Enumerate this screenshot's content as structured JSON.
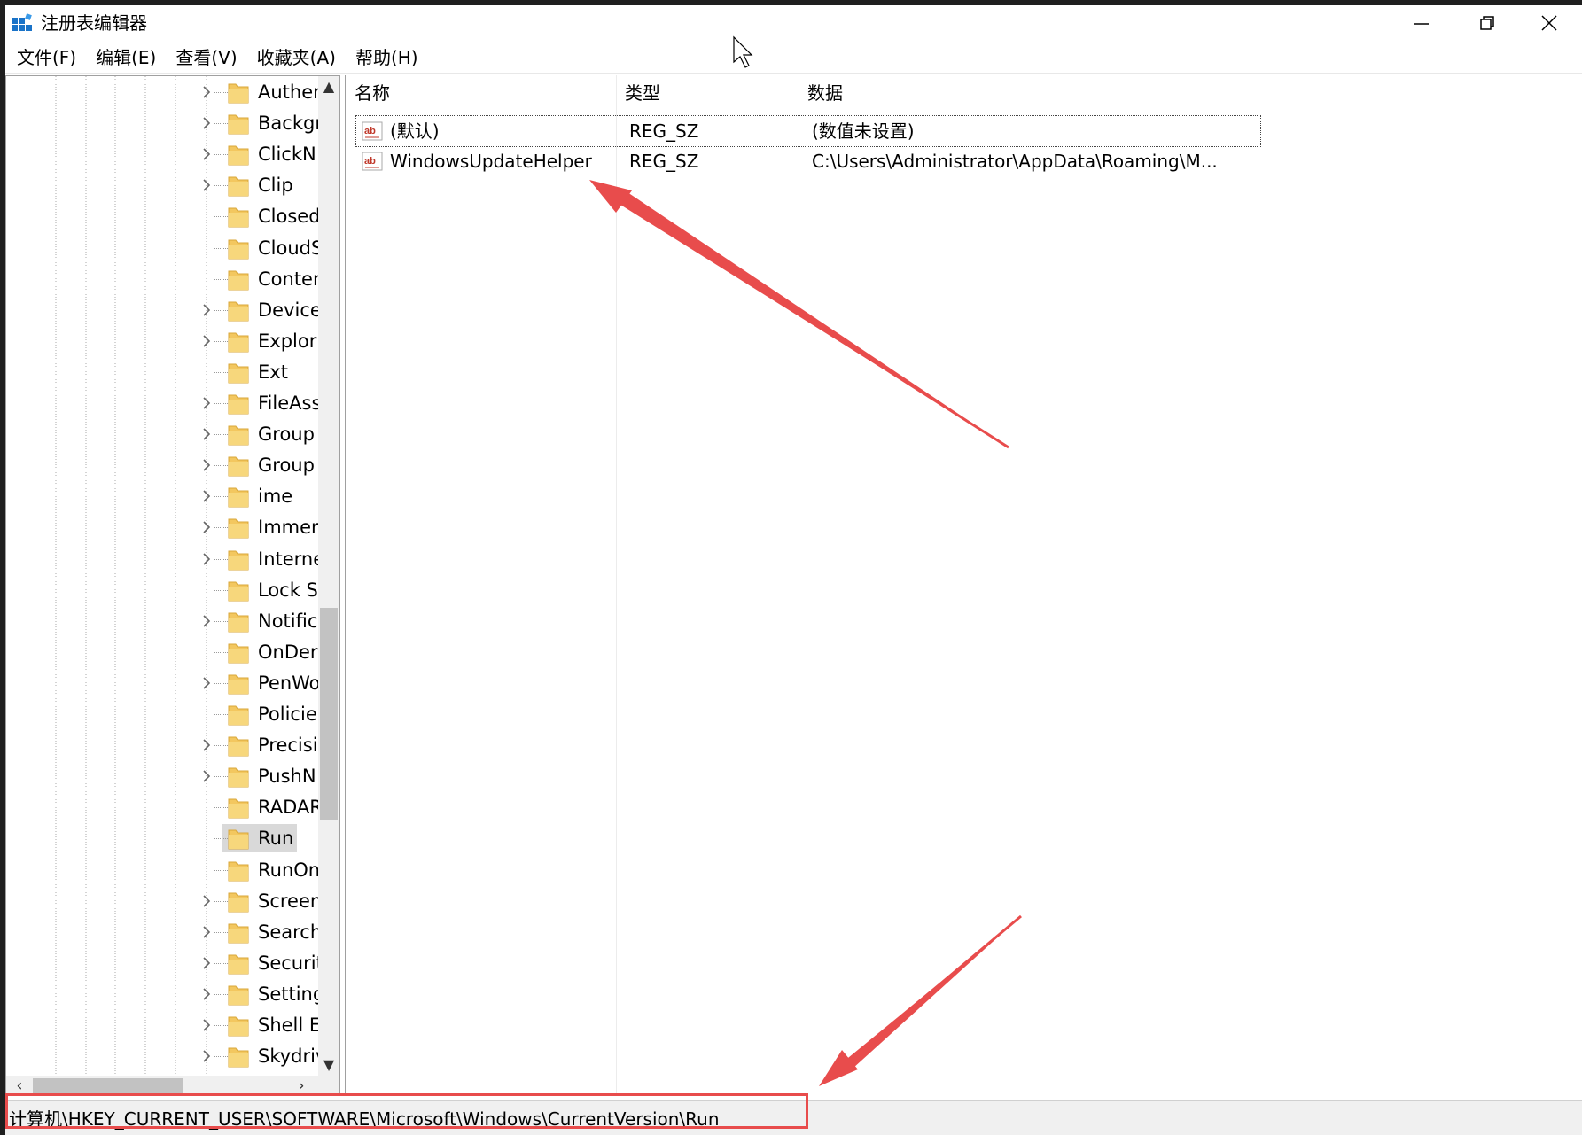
{
  "window": {
    "title": "注册表编辑器",
    "controls": {
      "minimize": "minimize",
      "maximize": "restore",
      "close": "close"
    }
  },
  "menu": [
    "文件(F)",
    "编辑(E)",
    "查看(V)",
    "收藏夹(A)",
    "帮助(H)"
  ],
  "tree": {
    "items": [
      {
        "label": "Authen",
        "expandable": true
      },
      {
        "label": "Backgr",
        "expandable": true
      },
      {
        "label": "ClickN",
        "expandable": true
      },
      {
        "label": "Clip",
        "expandable": true
      },
      {
        "label": "Closed",
        "expandable": false
      },
      {
        "label": "CloudS",
        "expandable": false
      },
      {
        "label": "Conten",
        "expandable": false
      },
      {
        "label": "Device",
        "expandable": true
      },
      {
        "label": "Explor",
        "expandable": true
      },
      {
        "label": "Ext",
        "expandable": false
      },
      {
        "label": "FileAss",
        "expandable": true
      },
      {
        "label": "Group",
        "expandable": true
      },
      {
        "label": "Group",
        "expandable": true
      },
      {
        "label": "ime",
        "expandable": true
      },
      {
        "label": "Immer",
        "expandable": true
      },
      {
        "label": "Interne",
        "expandable": true
      },
      {
        "label": "Lock S",
        "expandable": false
      },
      {
        "label": "Notific",
        "expandable": true
      },
      {
        "label": "OnDer",
        "expandable": false
      },
      {
        "label": "PenWo",
        "expandable": true
      },
      {
        "label": "Policie",
        "expandable": false
      },
      {
        "label": "Precisi",
        "expandable": true
      },
      {
        "label": "PushN",
        "expandable": true
      },
      {
        "label": "RADAR",
        "expandable": false
      },
      {
        "label": "Run",
        "expandable": false,
        "selected": true
      },
      {
        "label": "RunOn",
        "expandable": false
      },
      {
        "label": "Screen",
        "expandable": true
      },
      {
        "label": "Search",
        "expandable": true
      },
      {
        "label": "Securit",
        "expandable": true
      },
      {
        "label": "Setting",
        "expandable": true
      },
      {
        "label": "Shell E",
        "expandable": true
      },
      {
        "label": "Skydriv",
        "expandable": true
      }
    ]
  },
  "list": {
    "columns": {
      "name": "名称",
      "type": "类型",
      "data": "数据"
    },
    "rows": [
      {
        "name": "(默认)",
        "type": "REG_SZ",
        "data": "(数值未设置)",
        "icon": "string-value-icon",
        "focused": true
      },
      {
        "name": "WindowsUpdateHelper",
        "type": "REG_SZ",
        "data": "C:\\Users\\Administrator\\AppData\\Roaming\\M...",
        "icon": "string-value-icon",
        "focused": false
      }
    ]
  },
  "status": {
    "path": "计算机\\HKEY_CURRENT_USER\\SOFTWARE\\Microsoft\\Windows\\CurrentVersion\\Run"
  },
  "colors": {
    "annotation": "#e84c4c",
    "folder": "#f3c75f",
    "selection": "#d9d9d9"
  }
}
